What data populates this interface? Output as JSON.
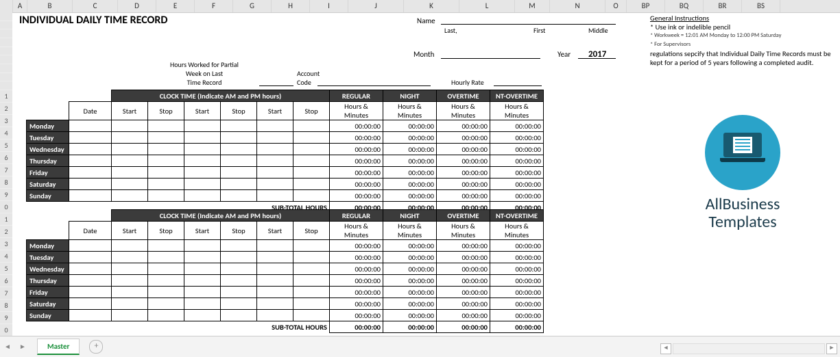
{
  "columns": [
    "",
    "A",
    "B",
    "C",
    "D",
    "E",
    "F",
    "G",
    "H",
    "I",
    "J",
    "K",
    "L",
    "M",
    "N",
    "O",
    "BP",
    "BQ",
    "BR",
    "BS"
  ],
  "rownums": [
    "",
    "",
    "",
    "",
    "",
    "",
    "",
    "",
    "",
    "1",
    "2",
    "3",
    "4",
    "5",
    "6",
    "7",
    "8",
    "9",
    "0",
    "1",
    "2",
    "3",
    "4",
    "5",
    "6",
    "7",
    "8",
    "9",
    "0"
  ],
  "title": "INDIVIDUAL DAILY TIME RECORD",
  "name_label": "Name",
  "name_hints": {
    "last": "Last,",
    "first": "First",
    "middle": "Middle"
  },
  "month_label": "Month",
  "year_label": "Year",
  "year_value": "2017",
  "partial_label_l1": "Hours Worked for Partial",
  "partial_label_l2": "Week on Last",
  "partial_label_l3": "Time Record",
  "account_label": "Account",
  "code_label": "Code",
  "hourly_rate_label": "Hourly Rate",
  "clock_header": "CLOCK TIME (Indicate AM and PM hours)",
  "cat": {
    "regular": "REGULAR",
    "night": "NIGHT",
    "overtime": "OVERTIME",
    "ntovertime": "NT-OVERTIME"
  },
  "hm": "Hours & Minutes",
  "date": "Date",
  "start": "Start",
  "stop": "Stop",
  "days": [
    "Monday",
    "Tuesday",
    "Wednesday",
    "Thursday",
    "Friday",
    "Saturday",
    "Sunday"
  ],
  "zero": "00:00:00",
  "subtotal": "SUB-TOTAL HOURS",
  "instr": {
    "title": "General Instructions",
    "l1": "* Use ink or indelible pencil",
    "l2": "* Workweek = 12:01 AM Monday to 12:00 PM Saturday",
    "l3": "* For Supervisors",
    "l4": "regulations sepcify that Individual Daily Time Records must be kept for a period of 5 years following a completed audit."
  },
  "logo": {
    "l1": "AllBusiness",
    "l2": "Templates"
  },
  "tab": "Master"
}
